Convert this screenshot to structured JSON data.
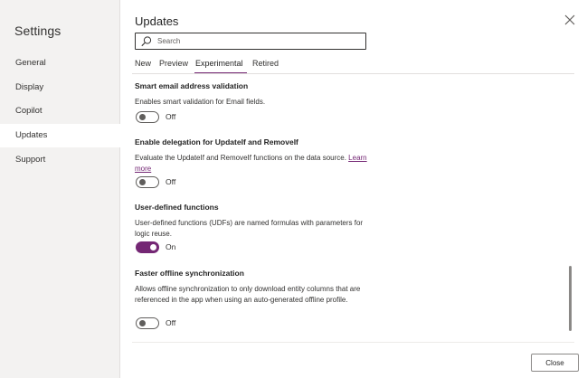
{
  "sidebar": {
    "title": "Settings",
    "items": [
      {
        "label": "General"
      },
      {
        "label": "Display"
      },
      {
        "label": "Copilot"
      },
      {
        "label": "Updates",
        "active": true
      },
      {
        "label": "Support"
      }
    ]
  },
  "main": {
    "title": "Updates",
    "search": {
      "placeholder": "Search",
      "value": ""
    },
    "tabs": [
      {
        "label": "New"
      },
      {
        "label": "Preview"
      },
      {
        "label": "Experimental",
        "active": true
      },
      {
        "label": "Retired"
      }
    ],
    "settings": [
      {
        "title": "Smart email address validation",
        "description": "Enables smart validation for Email fields.",
        "state": "off",
        "state_label": "Off"
      },
      {
        "title": "Enable delegation for UpdateIf and RemoveIf",
        "description": "Evaluate the UpdateIf and RemoveIf functions on the data source.",
        "link": "Learn more",
        "state": "off",
        "state_label": "Off"
      },
      {
        "title": "User-defined functions",
        "description": "User-defined functions (UDFs) are named formulas with parameters for logic reuse.",
        "state": "on",
        "state_label": "On"
      },
      {
        "title": "Faster offline synchronization",
        "description": "Allows offline synchronization to only download entity columns that are referenced in the app when using an auto-generated offline profile.",
        "state": "off",
        "state_label": "Off"
      }
    ],
    "close_button": "Close"
  },
  "colors": {
    "accent": "#742774",
    "sidebar_bg": "#f3f2f1"
  },
  "icons": [
    "search-icon",
    "close-icon"
  ]
}
